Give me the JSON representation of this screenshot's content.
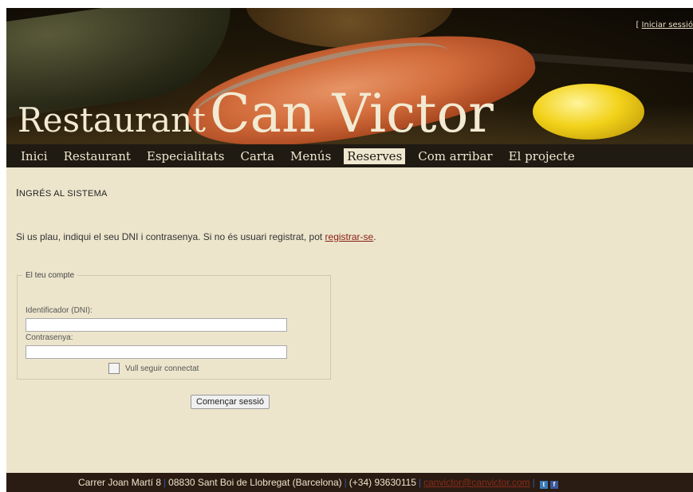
{
  "header": {
    "title_part1": "Restaurant",
    "title_part2": "Can Victor",
    "login_prefix": "[",
    "login_link": "Iniciar sessió"
  },
  "nav": {
    "items": [
      {
        "label": "Inici"
      },
      {
        "label": "Restaurant"
      },
      {
        "label": "Especialitats"
      },
      {
        "label": "Carta"
      },
      {
        "label": "Menús"
      },
      {
        "label": "Reserves",
        "active": true
      },
      {
        "label": "Com arribar"
      },
      {
        "label": "El projecte"
      }
    ]
  },
  "main": {
    "heading_first": "I",
    "heading_rest": "NGRÉS AL SISTEMA",
    "intro_text": "Si us plau, indiqui el seu DNI i contrasenya. Si no és usuari registrat, pot ",
    "register_link": "registrar-se",
    "intro_end": ".",
    "fieldset_legend": "El teu compte",
    "id_label": "Identificador (DNI):",
    "id_value": "",
    "password_label": "Contrasenya:",
    "password_value": "",
    "remember_label": "Vull seguir connectat",
    "remember_checked": false,
    "submit_label": "Començar sessió"
  },
  "footer": {
    "address": "Carrer Joan Martí 8",
    "city": "08830 Sant Boi de Llobregat (Barcelona)",
    "phone": "(+34) 93630115",
    "email": "canvictor@canvictor.com",
    "separator": "|"
  },
  "colors": {
    "nav_bg": "#1f1a12",
    "content_bg": "#ece5cc",
    "footer_bg": "#2a1c12",
    "link": "#8a1d12"
  }
}
